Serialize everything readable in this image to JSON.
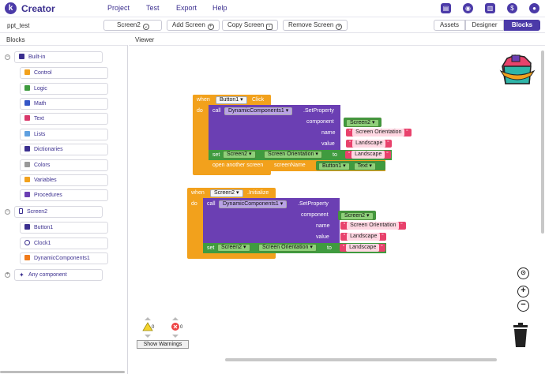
{
  "app": {
    "logo_letter": "k",
    "brand": "Creator"
  },
  "menu": {
    "project": "Project",
    "test": "Test",
    "export": "Export",
    "help": "Help"
  },
  "topicons": [
    "folder-icon",
    "palette-icon",
    "book-icon",
    "dollar-icon",
    "user-icon"
  ],
  "toolbar": {
    "project_name": "ppt_test",
    "screen_selector": "Screen2",
    "add_screen": "Add Screen",
    "copy_screen": "Copy Screen",
    "remove_screen": "Remove Screen",
    "assets": "Assets",
    "designer": "Designer",
    "blocks": "Blocks"
  },
  "panels": {
    "blocks_title": "Blocks",
    "viewer_title": "Viewer"
  },
  "tree": {
    "builtin": "Built-in",
    "builtin_items": [
      {
        "label": "Control",
        "color": "#f2a11c"
      },
      {
        "label": "Logic",
        "color": "#3f9b3f"
      },
      {
        "label": "Math",
        "color": "#3556c7"
      },
      {
        "label": "Text",
        "color": "#d9386b"
      },
      {
        "label": "Lists",
        "color": "#5fa0e0"
      },
      {
        "label": "Dictionaries",
        "color": "#3b2f8f"
      },
      {
        "label": "Colors",
        "color": "#999999"
      },
      {
        "label": "Variables",
        "color": "#f2a11c"
      },
      {
        "label": "Procedures",
        "color": "#6b3fb3"
      }
    ],
    "screen": "Screen2",
    "screen_items": [
      {
        "label": "Button1"
      },
      {
        "label": "Clock1"
      },
      {
        "label": "DynamicComponents1"
      }
    ],
    "any_component": "Any component"
  },
  "blocks1": {
    "when": "when",
    "component": "Button1",
    "event": "Click",
    "do": "do",
    "call": "call",
    "dyn": "DynamicComponents1",
    "method": ".SetProperty",
    "arg_component": "component",
    "arg_name": "name",
    "arg_value": "value",
    "screen_chip": "Screen2",
    "name_text": "Screen Orientation",
    "value_text": "Landscape",
    "set": "set",
    "set_comp": "Screen2",
    "set_prop": "Screen Orientation",
    "to": "to",
    "to_text": "Landscape",
    "open": "open another screen",
    "screenName": "screenName",
    "btn_chip": "Button1",
    "text_chip": "Text"
  },
  "blocks2": {
    "when": "when",
    "component": "Screen2",
    "event": ".Initialize",
    "do": "do",
    "call": "call",
    "dyn": "DynamicComponents1",
    "method": ".SetProperty",
    "arg_component": "component",
    "arg_name": "name",
    "arg_value": "value",
    "screen_chip": "Screen2",
    "name_text": "Screen Orientation",
    "value_text": "Landscape",
    "set": "set",
    "set_comp": "Screen2",
    "set_prop": "Screen Orientation",
    "to": "to",
    "to_text": "Landscape"
  },
  "warnings": {
    "warn_count": "0",
    "error_count": "0",
    "button": "Show Warnings"
  },
  "colors": {
    "accent": "#4b3aa8",
    "event": "#f2a11c",
    "call": "#6b3fb3",
    "set": "#3f9b3f",
    "text": "#e8426c"
  }
}
